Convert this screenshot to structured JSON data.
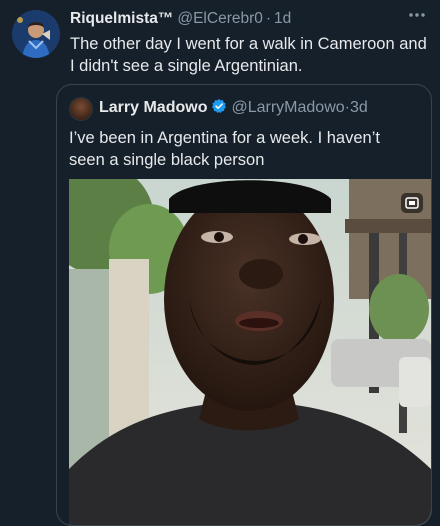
{
  "tweet": {
    "author_name": "Riquelmista™",
    "handle": "@ElCerebr0",
    "separator": "·",
    "time": "1d",
    "text": "The other day I went for a walk in Cameroon and I didn't see a single Argentinian."
  },
  "quoted_tweet": {
    "author_name": "Larry Madowo",
    "handle": "@LarryMadowo",
    "separator": "·",
    "time": "3d",
    "text": "I’ve been in Argentina for a week. I haven’t seen a single black person"
  },
  "colors": {
    "background": "#15202b",
    "text": "#e7e9ea",
    "muted": "#8b98a5",
    "verified": "#1d9bf0",
    "border": "#38444d"
  },
  "icons": [
    "more-options-icon",
    "verified-badge-icon",
    "media-expand-icon"
  ]
}
